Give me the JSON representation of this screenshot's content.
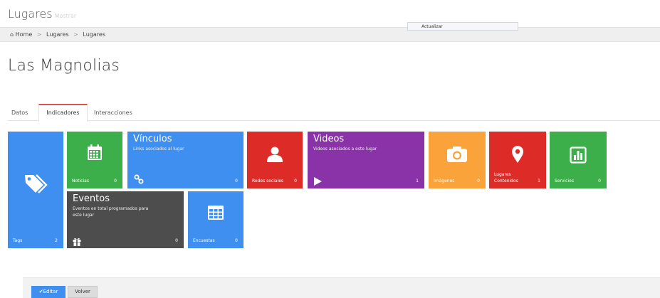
{
  "header": {
    "title": "Lugares",
    "subtitle": "Mostrar"
  },
  "breadcrumb": {
    "items": [
      "Home",
      "Lugares",
      "Lugares"
    ],
    "separator": ">"
  },
  "update_button": {
    "label": "Actualizar"
  },
  "page_title": "Las Magnolias",
  "tabs": [
    {
      "label": "Datos",
      "active": false
    },
    {
      "label": "Indicadores",
      "active": true
    },
    {
      "label": "Interacciones",
      "active": false
    }
  ],
  "tiles": {
    "tags": {
      "label": "Tags",
      "count": "2",
      "icon": "tags-icon",
      "color": "#3f8ff0"
    },
    "noticias": {
      "label": "Noticias",
      "count": "0",
      "icon": "calendar-icon",
      "color": "#3cae4a"
    },
    "vinculos": {
      "title": "Vínculos",
      "desc": "Links asociados al lugar",
      "count": "0",
      "icon": "link-icon",
      "color": "#3f8ff0"
    },
    "redes": {
      "label": "Redes sociales",
      "count": "0",
      "icon": "user-icon",
      "color": "#dd2b28"
    },
    "videos": {
      "title": "Videos",
      "desc": "Videos asociados a este lugar",
      "count": "1",
      "icon": "play-icon",
      "color": "#8a32a8"
    },
    "imagenes": {
      "label": "Imágenes",
      "count": "0",
      "icon": "camera-icon",
      "color": "#f9a33a"
    },
    "lugares": {
      "label_line1": "Lugares",
      "label_line2": "Contenidos",
      "count": "1",
      "icon": "map-marker-icon",
      "color": "#dd2b28"
    },
    "servicios": {
      "label": "Servicios",
      "count": "0",
      "icon": "bar-chart-icon",
      "color": "#3cae4a"
    },
    "eventos": {
      "title": "Eventos",
      "desc_line1": "Eventos en total programados para",
      "desc_line2": "este lugar",
      "count": "0",
      "icon": "gift-icon",
      "color": "#4d4d4d"
    },
    "encuestas": {
      "label": "Encuestas",
      "count": "0",
      "icon": "table-icon",
      "color": "#3f8ff0"
    }
  },
  "footer": {
    "edit_label": "Editar",
    "back_label": "Volver"
  }
}
